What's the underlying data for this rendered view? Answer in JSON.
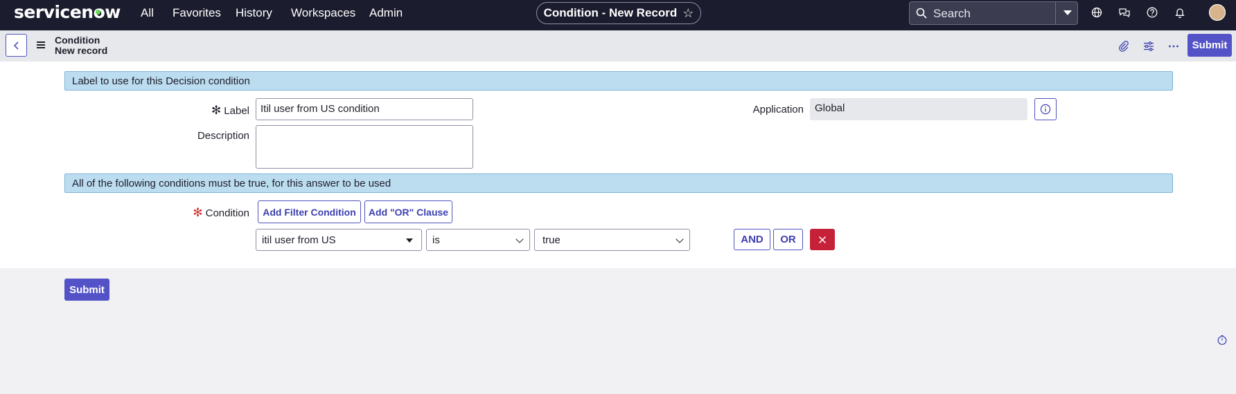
{
  "brand": {
    "logo_text": "servicenow",
    "accent": "#62d84e"
  },
  "nav": {
    "links": [
      "All",
      "Favorites",
      "History",
      "Workspaces",
      "Admin"
    ],
    "record_title": "Condition - New Record",
    "star_icon": "star-icon",
    "search_placeholder": "Search",
    "icons": [
      "globe-icon",
      "chat-icon",
      "help-icon",
      "bell-icon"
    ]
  },
  "record_header": {
    "table": "Condition",
    "subtitle": "New record",
    "icons": [
      "paperclip-icon",
      "sliders-icon",
      "more-icon"
    ],
    "submit_label": "Submit"
  },
  "form": {
    "section1": "Label to use for this Decision condition",
    "label_label": "Label",
    "label_value": "Itil user from US condition",
    "description_label": "Description",
    "description_value": "",
    "application_label": "Application",
    "application_value": "Global",
    "section2": "All of the following conditions must be true, for this answer to be used",
    "condition_label": "Condition",
    "add_filter_label": "Add Filter Condition",
    "add_or_label": "Add \"OR\" Clause",
    "condition_row": {
      "field": "itil user from US",
      "operator": "is",
      "value": "true",
      "and_label": "AND",
      "or_label": "OR"
    },
    "submit_label": "Submit"
  },
  "colors": {
    "primary": "#5352c6",
    "danger": "#c5223a",
    "section_bg": "#bcdcf0",
    "nav_bg": "#1b1c2e"
  }
}
